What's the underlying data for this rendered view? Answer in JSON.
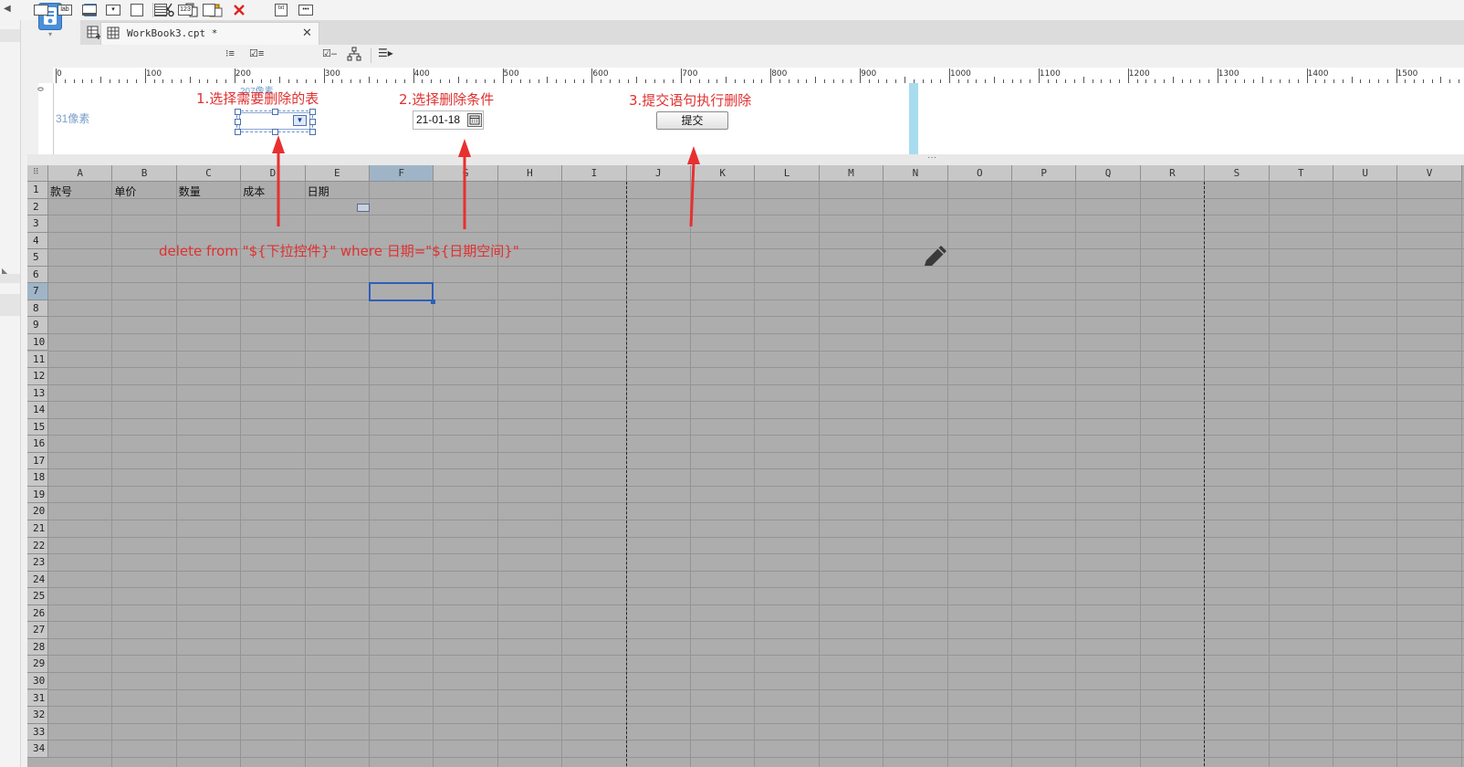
{
  "document": {
    "tab_title": "WorkBook3.cpt *"
  },
  "ruler": {
    "labels": [
      "0",
      "100",
      "200",
      "300",
      "400",
      "500",
      "600",
      "700",
      "800",
      "900",
      "1000",
      "1100",
      "1200",
      "1300",
      "1400",
      "1500"
    ]
  },
  "param_panel": {
    "width_label": "207像素",
    "height_label": "31像素",
    "date_value": "21-01-18",
    "submit_label": "提交"
  },
  "sheet": {
    "columns": [
      "A",
      "B",
      "C",
      "D",
      "E",
      "F",
      "G",
      "H",
      "I",
      "J",
      "K",
      "L",
      "M",
      "N",
      "O",
      "P",
      "Q",
      "R",
      "S",
      "T",
      "U",
      "V"
    ],
    "selected_column": "F",
    "selected_row": "7",
    "header_row_values": [
      "款号",
      "单价",
      "数量",
      "成本",
      "日期"
    ],
    "rows": [
      "1",
      "2",
      "3",
      "4",
      "5",
      "6",
      "7",
      "8",
      "9",
      "10",
      "11",
      "12",
      "13",
      "14",
      "15",
      "16",
      "17",
      "18",
      "19",
      "20",
      "21",
      "22",
      "23",
      "24",
      "25",
      "26",
      "27",
      "28",
      "29",
      "30",
      "31",
      "32",
      "33",
      "34"
    ]
  },
  "annotations": {
    "step1": "1.选择需要删除的表",
    "step2": "2.选择删除条件",
    "step3": "3.提交语句执行删除",
    "sql": "delete from \"${下拉控件}\" where 日期=\"${日期空间}\""
  },
  "colors": {
    "annotation": "#e03030",
    "selection": "#2d5fb8",
    "sheet_bg": "#adadad",
    "panel_bar": "#a8dcef"
  },
  "icons": [
    "save-icon",
    "undo-icon",
    "redo-icon",
    "cut-icon",
    "copy-icon",
    "paste-icon",
    "delete-icon",
    "pencil-icon",
    "calendar-icon",
    "dropdown-arrow-icon"
  ]
}
